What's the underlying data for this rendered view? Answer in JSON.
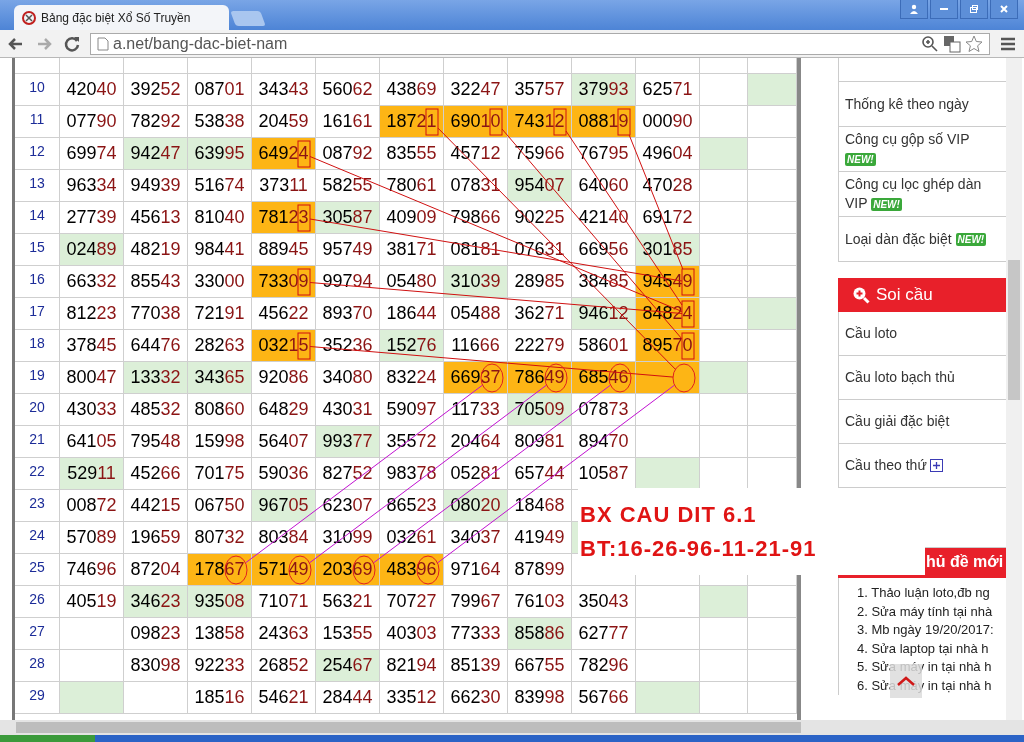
{
  "browser": {
    "tab_title": "Bảng đặc biệt Xổ Số Truyền",
    "url": "a.net/bang-dac-biet-nam"
  },
  "table": {
    "rows": [
      {
        "label": "10",
        "cells": [
          {
            "value": "42040",
            "kind": "plain"
          },
          {
            "value": "39252",
            "kind": "plain"
          },
          {
            "value": "08701",
            "kind": "plain"
          },
          {
            "value": "34343",
            "kind": "plain"
          },
          {
            "value": "56062",
            "kind": "plain"
          },
          {
            "value": "43869",
            "kind": "plain"
          },
          {
            "value": "32247",
            "kind": "plain"
          },
          {
            "value": "35757",
            "kind": "plain"
          },
          {
            "value": "37993",
            "color": "#dcefd8",
            "kind": "plain"
          },
          {
            "value": "62571",
            "kind": "plain"
          },
          {
            "kind": "plain"
          },
          {
            "color": "#dcefd8",
            "kind": "plain"
          }
        ]
      },
      {
        "label": "11",
        "cells": [
          {
            "value": "07790",
            "kind": "plain"
          },
          {
            "value": "78292",
            "kind": "plain"
          },
          {
            "value": "53838",
            "kind": "plain"
          },
          {
            "value": "20459",
            "kind": "plain"
          },
          {
            "value": "16161",
            "kind": "plain"
          },
          {
            "value": "18721",
            "color": "#fdb515",
            "kind": "boxed"
          },
          {
            "value": "69010",
            "color": "#fdb515",
            "kind": "boxed"
          },
          {
            "value": "74312",
            "color": "#fdb515",
            "kind": "boxed"
          },
          {
            "value": "08819",
            "color": "#fdb515",
            "kind": "boxed"
          },
          {
            "value": "00090",
            "kind": "plain"
          },
          {
            "kind": "plain"
          },
          {
            "kind": "plain"
          }
        ]
      },
      {
        "label": "12",
        "cells": [
          {
            "value": "69974",
            "kind": "plain"
          },
          {
            "value": "94247",
            "color": "#dcefd8",
            "kind": "plain"
          },
          {
            "value": "63995",
            "color": "#dcefd8",
            "kind": "plain"
          },
          {
            "value": "64924",
            "color": "#fdb515",
            "kind": "boxed"
          },
          {
            "value": "08792",
            "kind": "plain"
          },
          {
            "value": "83555",
            "kind": "plain"
          },
          {
            "value": "45712",
            "kind": "plain"
          },
          {
            "value": "75966",
            "kind": "plain"
          },
          {
            "value": "76795",
            "kind": "plain"
          },
          {
            "value": "49604",
            "kind": "plain"
          },
          {
            "color": "#dcefd8",
            "kind": "plain"
          },
          {
            "kind": "plain"
          }
        ]
      },
      {
        "label": "13",
        "cells": [
          {
            "value": "96334",
            "kind": "plain"
          },
          {
            "value": "94939",
            "kind": "plain"
          },
          {
            "value": "51674",
            "kind": "plain"
          },
          {
            "value": "37311",
            "kind": "plain"
          },
          {
            "value": "58255",
            "kind": "plain"
          },
          {
            "value": "78061",
            "kind": "plain"
          },
          {
            "value": "07831",
            "kind": "plain"
          },
          {
            "value": "95407",
            "color": "#dcefd8",
            "kind": "plain"
          },
          {
            "value": "64060",
            "kind": "plain"
          },
          {
            "value": "47028",
            "kind": "plain"
          },
          {
            "kind": "plain"
          },
          {
            "kind": "plain"
          }
        ]
      },
      {
        "label": "14",
        "cells": [
          {
            "value": "27739",
            "kind": "plain"
          },
          {
            "value": "45613",
            "kind": "plain"
          },
          {
            "value": "81040",
            "kind": "plain"
          },
          {
            "value": "78123",
            "color": "#fdb515",
            "kind": "boxed"
          },
          {
            "value": "30587",
            "color": "#dcefd8",
            "kind": "plain"
          },
          {
            "value": "40909",
            "kind": "plain"
          },
          {
            "value": "79866",
            "kind": "plain"
          },
          {
            "value": "90225",
            "kind": "plain"
          },
          {
            "value": "42140",
            "kind": "plain"
          },
          {
            "value": "69172",
            "kind": "plain"
          },
          {
            "kind": "plain"
          },
          {
            "kind": "plain"
          }
        ]
      },
      {
        "label": "15",
        "cells": [
          {
            "value": "02489",
            "color": "#dcefd8",
            "kind": "plain"
          },
          {
            "value": "48219",
            "kind": "plain"
          },
          {
            "value": "98441",
            "kind": "plain"
          },
          {
            "value": "88945",
            "kind": "plain"
          },
          {
            "value": "95749",
            "kind": "plain"
          },
          {
            "value": "38171",
            "kind": "plain"
          },
          {
            "value": "08181",
            "kind": "plain"
          },
          {
            "value": "07631",
            "kind": "plain"
          },
          {
            "value": "66956",
            "kind": "plain"
          },
          {
            "value": "30185",
            "color": "#dcefd8",
            "kind": "plain"
          },
          {
            "kind": "plain"
          },
          {
            "kind": "plain"
          }
        ]
      },
      {
        "label": "16",
        "cells": [
          {
            "value": "66332",
            "kind": "plain"
          },
          {
            "value": "85543",
            "kind": "plain"
          },
          {
            "value": "33000",
            "kind": "plain"
          },
          {
            "value": "73309",
            "color": "#fdb515",
            "kind": "boxed"
          },
          {
            "value": "99794",
            "kind": "plain"
          },
          {
            "value": "05480",
            "kind": "plain"
          },
          {
            "value": "31039",
            "color": "#dcefd8",
            "kind": "plain"
          },
          {
            "value": "28985",
            "kind": "plain"
          },
          {
            "value": "38485",
            "kind": "plain"
          },
          {
            "value": "94549",
            "color": "#fdb515",
            "kind": "boxed"
          },
          {
            "kind": "plain"
          },
          {
            "kind": "plain"
          }
        ]
      },
      {
        "label": "17",
        "cells": [
          {
            "value": "81223",
            "kind": "plain"
          },
          {
            "value": "77038",
            "kind": "plain"
          },
          {
            "value": "72191",
            "kind": "plain"
          },
          {
            "value": "45622",
            "kind": "plain"
          },
          {
            "value": "89370",
            "kind": "plain"
          },
          {
            "value": "18644",
            "kind": "plain"
          },
          {
            "value": "05488",
            "kind": "plain"
          },
          {
            "value": "36271",
            "kind": "plain"
          },
          {
            "value": "94612",
            "color": "#dcefd8",
            "kind": "plain"
          },
          {
            "value": "84824",
            "color": "#fdb515",
            "kind": "boxed"
          },
          {
            "kind": "plain"
          },
          {
            "color": "#dcefd8",
            "kind": "plain"
          }
        ]
      },
      {
        "label": "18",
        "cells": [
          {
            "value": "37845",
            "kind": "plain"
          },
          {
            "value": "64476",
            "kind": "plain"
          },
          {
            "value": "28263",
            "kind": "plain"
          },
          {
            "value": "03215",
            "color": "#fdb515",
            "kind": "boxed"
          },
          {
            "value": "35236",
            "kind": "plain"
          },
          {
            "value": "15276",
            "color": "#dcefd8",
            "kind": "plain"
          },
          {
            "value": "11666",
            "kind": "plain"
          },
          {
            "value": "22279",
            "kind": "plain"
          },
          {
            "value": "58601",
            "kind": "plain"
          },
          {
            "value": "89570",
            "color": "#fdb515",
            "kind": "boxed"
          },
          {
            "kind": "plain"
          },
          {
            "kind": "plain"
          }
        ]
      },
      {
        "label": "19",
        "cells": [
          {
            "value": "80047",
            "kind": "plain"
          },
          {
            "value": "13332",
            "color": "#dcefd8",
            "kind": "plain"
          },
          {
            "value": "34365",
            "color": "#dcefd8",
            "kind": "plain"
          },
          {
            "value": "92086",
            "kind": "plain"
          },
          {
            "value": "34080",
            "kind": "plain"
          },
          {
            "value": "83224",
            "kind": "plain"
          },
          {
            "value": "66937",
            "color": "#fdb515",
            "kind": "circled"
          },
          {
            "value": "78649",
            "color": "#fdb515",
            "kind": "circled"
          },
          {
            "value": "68546",
            "color": "#fdb515",
            "kind": "circled"
          },
          {
            "color": "#fdb515",
            "kind": "circled"
          },
          {
            "color": "#dcefd8",
            "kind": "plain"
          },
          {
            "kind": "plain"
          }
        ]
      },
      {
        "label": "20",
        "cells": [
          {
            "value": "43033",
            "kind": "plain"
          },
          {
            "value": "48532",
            "kind": "plain"
          },
          {
            "value": "80860",
            "kind": "plain"
          },
          {
            "value": "64829",
            "kind": "plain"
          },
          {
            "value": "43031",
            "kind": "plain"
          },
          {
            "value": "59097",
            "kind": "plain"
          },
          {
            "value": "11733",
            "kind": "plain"
          },
          {
            "value": "70509",
            "color": "#dcefd8",
            "kind": "plain"
          },
          {
            "value": "07873",
            "kind": "plain"
          },
          {
            "kind": "plain"
          },
          {
            "kind": "plain"
          },
          {
            "kind": "plain"
          }
        ]
      },
      {
        "label": "21",
        "cells": [
          {
            "value": "64105",
            "kind": "plain"
          },
          {
            "value": "79548",
            "kind": "plain"
          },
          {
            "value": "15998",
            "kind": "plain"
          },
          {
            "value": "56407",
            "kind": "plain"
          },
          {
            "value": "99377",
            "color": "#dcefd8",
            "kind": "plain"
          },
          {
            "value": "35572",
            "kind": "plain"
          },
          {
            "value": "20464",
            "kind": "plain"
          },
          {
            "value": "80981",
            "kind": "plain"
          },
          {
            "value": "89470",
            "kind": "plain"
          },
          {
            "kind": "plain"
          },
          {
            "kind": "plain"
          },
          {
            "kind": "plain"
          }
        ]
      },
      {
        "label": "22",
        "cells": [
          {
            "value": "52911",
            "color": "#dcefd8",
            "kind": "plain"
          },
          {
            "value": "45266",
            "kind": "plain"
          },
          {
            "value": "70175",
            "kind": "plain"
          },
          {
            "value": "59036",
            "kind": "plain"
          },
          {
            "value": "82752",
            "kind": "plain"
          },
          {
            "value": "98378",
            "kind": "plain"
          },
          {
            "value": "05281",
            "kind": "plain"
          },
          {
            "value": "65744",
            "kind": "plain"
          },
          {
            "value": "10587",
            "kind": "plain"
          },
          {
            "color": "#dcefd8",
            "kind": "plain"
          },
          {
            "kind": "plain"
          },
          {
            "kind": "plain"
          }
        ]
      },
      {
        "label": "23",
        "cells": [
          {
            "value": "00872",
            "kind": "plain"
          },
          {
            "value": "44215",
            "kind": "plain"
          },
          {
            "value": "06750",
            "kind": "plain"
          },
          {
            "value": "96705",
            "color": "#dcefd8",
            "kind": "plain"
          },
          {
            "value": "62307",
            "kind": "plain"
          },
          {
            "value": "86523",
            "kind": "plain"
          },
          {
            "value": "08020",
            "color": "#dcefd8",
            "kind": "plain"
          },
          {
            "value": "18468",
            "kind": "plain"
          },
          {
            "kind": "plain"
          },
          {
            "kind": "plain"
          },
          {
            "kind": "plain"
          },
          {
            "kind": "plain"
          }
        ]
      },
      {
        "label": "24",
        "cells": [
          {
            "value": "57089",
            "kind": "plain"
          },
          {
            "value": "19659",
            "kind": "plain"
          },
          {
            "value": "80732",
            "kind": "plain"
          },
          {
            "value": "80384",
            "kind": "plain"
          },
          {
            "value": "31099",
            "kind": "plain"
          },
          {
            "value": "03261",
            "kind": "plain"
          },
          {
            "value": "34037",
            "kind": "plain"
          },
          {
            "value": "41949",
            "kind": "plain"
          },
          {
            "color": "#dcefd8",
            "kind": "plain"
          },
          {
            "kind": "plain"
          },
          {
            "kind": "plain"
          },
          {
            "kind": "plain"
          }
        ]
      },
      {
        "label": "25",
        "cells": [
          {
            "value": "74696",
            "kind": "plain"
          },
          {
            "value": "87204",
            "kind": "plain"
          },
          {
            "value": "17867",
            "color": "#fdb515",
            "kind": "circled"
          },
          {
            "value": "57149",
            "color": "#fdb515",
            "kind": "circled"
          },
          {
            "value": "20369",
            "color": "#fdb515",
            "kind": "circled"
          },
          {
            "value": "48396",
            "color": "#fdb515",
            "kind": "circled"
          },
          {
            "value": "97164",
            "kind": "plain"
          },
          {
            "value": "87899",
            "kind": "plain"
          },
          {
            "kind": "plain"
          },
          {
            "kind": "plain"
          },
          {
            "kind": "plain"
          },
          {
            "kind": "plain"
          }
        ]
      },
      {
        "label": "26",
        "cells": [
          {
            "value": "40519",
            "kind": "plain"
          },
          {
            "value": "34623",
            "color": "#dcefd8",
            "kind": "plain"
          },
          {
            "value": "93508",
            "color": "#dcefd8",
            "kind": "plain"
          },
          {
            "value": "71071",
            "kind": "plain"
          },
          {
            "value": "56321",
            "kind": "plain"
          },
          {
            "value": "70727",
            "kind": "plain"
          },
          {
            "value": "79967",
            "kind": "plain"
          },
          {
            "value": "76103",
            "kind": "plain"
          },
          {
            "value": "35043",
            "kind": "plain"
          },
          {
            "kind": "plain"
          },
          {
            "color": "#dcefd8",
            "kind": "plain"
          },
          {
            "kind": "plain"
          }
        ]
      },
      {
        "label": "27",
        "cells": [
          {
            "kind": "plain"
          },
          {
            "value": "09823",
            "kind": "plain"
          },
          {
            "value": "13858",
            "kind": "plain"
          },
          {
            "value": "24363",
            "kind": "plain"
          },
          {
            "value": "15355",
            "kind": "plain"
          },
          {
            "value": "40303",
            "kind": "plain"
          },
          {
            "value": "77333",
            "kind": "plain"
          },
          {
            "value": "85886",
            "color": "#dcefd8",
            "kind": "plain"
          },
          {
            "value": "62777",
            "kind": "plain"
          },
          {
            "kind": "plain"
          },
          {
            "kind": "plain"
          },
          {
            "kind": "plain"
          }
        ]
      },
      {
        "label": "28",
        "cells": [
          {
            "kind": "plain"
          },
          {
            "value": "83098",
            "kind": "plain"
          },
          {
            "value": "92233",
            "kind": "plain"
          },
          {
            "value": "26852",
            "kind": "plain"
          },
          {
            "value": "25467",
            "color": "#dcefd8",
            "kind": "plain"
          },
          {
            "value": "82194",
            "kind": "plain"
          },
          {
            "value": "85139",
            "kind": "plain"
          },
          {
            "value": "66755",
            "kind": "plain"
          },
          {
            "value": "78296",
            "kind": "plain"
          },
          {
            "kind": "plain"
          },
          {
            "kind": "plain"
          },
          {
            "kind": "plain"
          }
        ]
      },
      {
        "label": "29",
        "cells": [
          {
            "color": "#dcefd8",
            "kind": "plain"
          },
          {
            "kind": "plain"
          },
          {
            "value": "18516",
            "kind": "plain"
          },
          {
            "value": "54621",
            "kind": "plain"
          },
          {
            "value": "28444",
            "kind": "plain"
          },
          {
            "value": "33512",
            "kind": "plain"
          },
          {
            "value": "66230",
            "kind": "plain"
          },
          {
            "value": "83998",
            "kind": "plain"
          },
          {
            "value": "56766",
            "kind": "plain"
          },
          {
            "color": "#dcefd8",
            "kind": "plain"
          },
          {
            "kind": "plain"
          },
          {
            "kind": "plain"
          }
        ]
      }
    ]
  },
  "annotation": {
    "lines": [
      "BX CAU DIT 6.1",
      "BT:16-26-96-11-21-91"
    ]
  },
  "sidebar": {
    "stats_items": [
      {
        "label": "Thống kê theo ngày"
      },
      {
        "label": "Công cụ gộp số VIP",
        "badge": "NEW!"
      },
      {
        "label": "Công cụ lọc ghép dàn VIP",
        "badge": "NEW!"
      },
      {
        "label": "Loại dàn đặc biệt",
        "badge": "NEW!"
      }
    ],
    "soi_cau": {
      "title": "Soi cầu",
      "items": [
        {
          "label": "Cầu loto",
          "expandable": false
        },
        {
          "label": "Cầu loto bạch thủ",
          "expandable": false
        },
        {
          "label": "Cầu giải đặc biệt",
          "expandable": false
        },
        {
          "label": "Cầu theo thứ",
          "expandable": true
        }
      ]
    },
    "topics": {
      "title": "hủ đề mới",
      "items": [
        "1. Thảo luận loto,đb ng",
        "2. Sửa máy tính tại nhà",
        "3. Mb ngày 19/20/2017:",
        "4. Sửa laptop tại nhà h",
        "5. Sửa máy in tại nhà h",
        "6. Sửa máy in tại nhà h"
      ]
    }
  }
}
